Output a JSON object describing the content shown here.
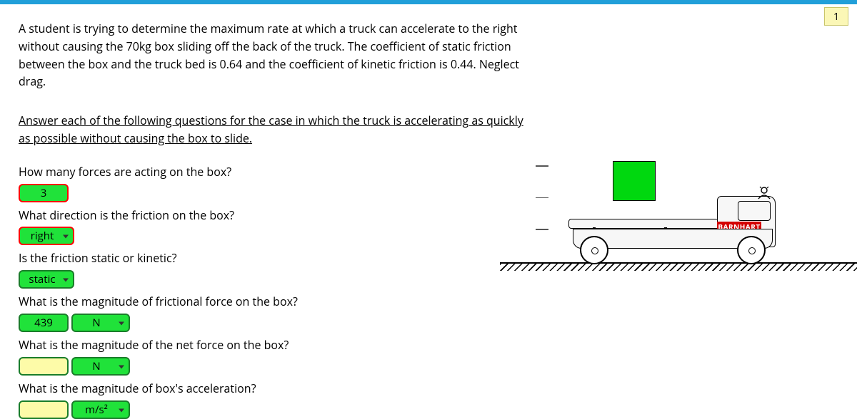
{
  "badge": "1",
  "problem_text": "A student is trying to determine the maximum rate at which a truck can accelerate to the right without causing the 70kg box sliding off the back of the truck. The coefficient of static friction between the box and the truck bed is 0.64 and the coefficient of kinetic friction is 0.44. Neglect drag.",
  "instruction": "Answer each of the following questions for the case in which the truck is accelerating as quickly as possible without causing the box to slide.",
  "q1": {
    "label": "How many forces are acting on the box?",
    "value": "3"
  },
  "q2": {
    "label": "What direction is the friction on the box?",
    "value": "right"
  },
  "q3": {
    "label": "Is the friction static or kinetic?",
    "value": "static"
  },
  "q4": {
    "label": "What is the magnitude of frictional force on the box?",
    "value": "439",
    "unit": "N"
  },
  "q5": {
    "label": "What is the magnitude of the net force on the box?",
    "value": "",
    "unit": "N"
  },
  "q6": {
    "label": "What is the magnitude of box's acceleration?",
    "value": "",
    "unit": "m/s²"
  },
  "truck_label": "BARNHART"
}
